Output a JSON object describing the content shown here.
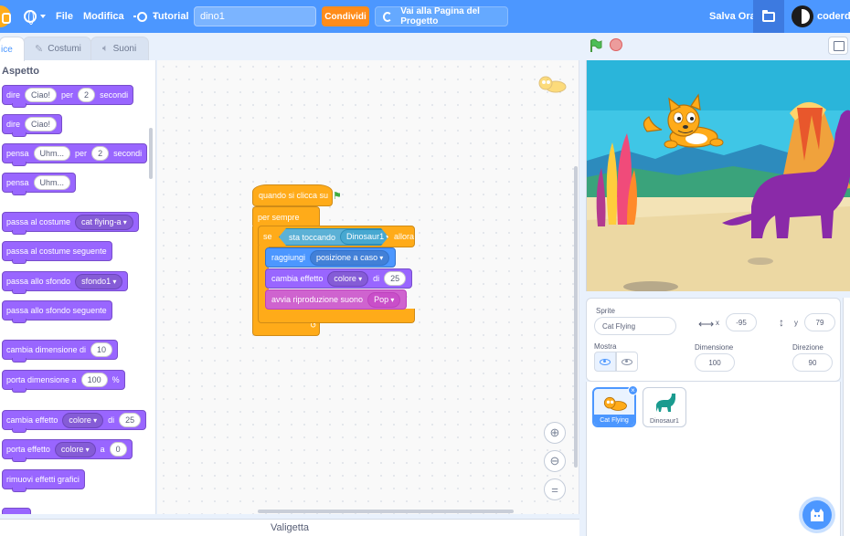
{
  "menubar": {
    "file": "File",
    "edit": "Modifica",
    "tutorial": "Tutorial",
    "project_title": "dino1",
    "share": "Condividi",
    "project_page": "Vai alla Pagina del Progetto",
    "save_now": "Salva Ora",
    "username": "coderdoj"
  },
  "tabs": {
    "code": "ice",
    "costumes": "Costumi",
    "sounds": "Suoni"
  },
  "palette": {
    "category": "Aspetto",
    "say_secs": {
      "t1": "dire",
      "v1": "Ciao!",
      "t2": "per",
      "v2": "2",
      "t3": "secondi"
    },
    "say": {
      "t1": "dire",
      "v1": "Ciao!"
    },
    "think_secs": {
      "t1": "pensa",
      "v1": "Uhm...",
      "t2": "per",
      "v2": "2",
      "t3": "secondi"
    },
    "think": {
      "t1": "pensa",
      "v1": "Uhm..."
    },
    "switch_costume": {
      "t1": "passa al costume",
      "v1": "cat flying-a"
    },
    "next_costume": "passa al costume seguente",
    "switch_backdrop": {
      "t1": "passa allo sfondo",
      "v1": "sfondo1"
    },
    "next_backdrop": "passa allo sfondo seguente",
    "change_size": {
      "t1": "cambia dimensione di",
      "v1": "10"
    },
    "set_size": {
      "t1": "porta dimensione a",
      "v1": "100",
      "t2": "%"
    },
    "change_effect": {
      "t1": "cambia effetto",
      "v1": "colore",
      "t2": "di",
      "v2": "25"
    },
    "set_effect": {
      "t1": "porta effetto",
      "v1": "colore",
      "t2": "a",
      "v2": "0"
    },
    "clear_effects": "rimuovi effetti grafici"
  },
  "script": {
    "when_flag": "quando si clicca su",
    "forever": "per sempre",
    "if": "se",
    "touching": "sta toccando",
    "touching_target": "Dinosaur1",
    "then": "allora",
    "goto": "raggiungi",
    "goto_target": "posizione a caso",
    "change_effect": "cambia effetto",
    "effect": "colore",
    "by": "di",
    "effect_amount": "25",
    "play_sound": "avvia riproduzione suono",
    "sound": "Pop"
  },
  "backpack": "Valigetta",
  "sprite_info": {
    "sprite_label": "Sprite",
    "sprite_name": "Cat Flying",
    "x_label": "x",
    "x": "-95",
    "y_label": "y",
    "y": "79",
    "show_label": "Mostra",
    "size_label": "Dimensione",
    "size": "100",
    "direction_label": "Direzione",
    "direction": "90"
  },
  "sprites": [
    {
      "name": "Cat Flying"
    },
    {
      "name": "Dinosaur1"
    }
  ],
  "colors": {
    "menubar": "#4c97ff",
    "looks": "#9966ff",
    "control": "#ffab19",
    "motion": "#4c97ff",
    "sound": "#cf63cf",
    "sensing": "#5cb1d6",
    "share": "#ff8c1a"
  }
}
